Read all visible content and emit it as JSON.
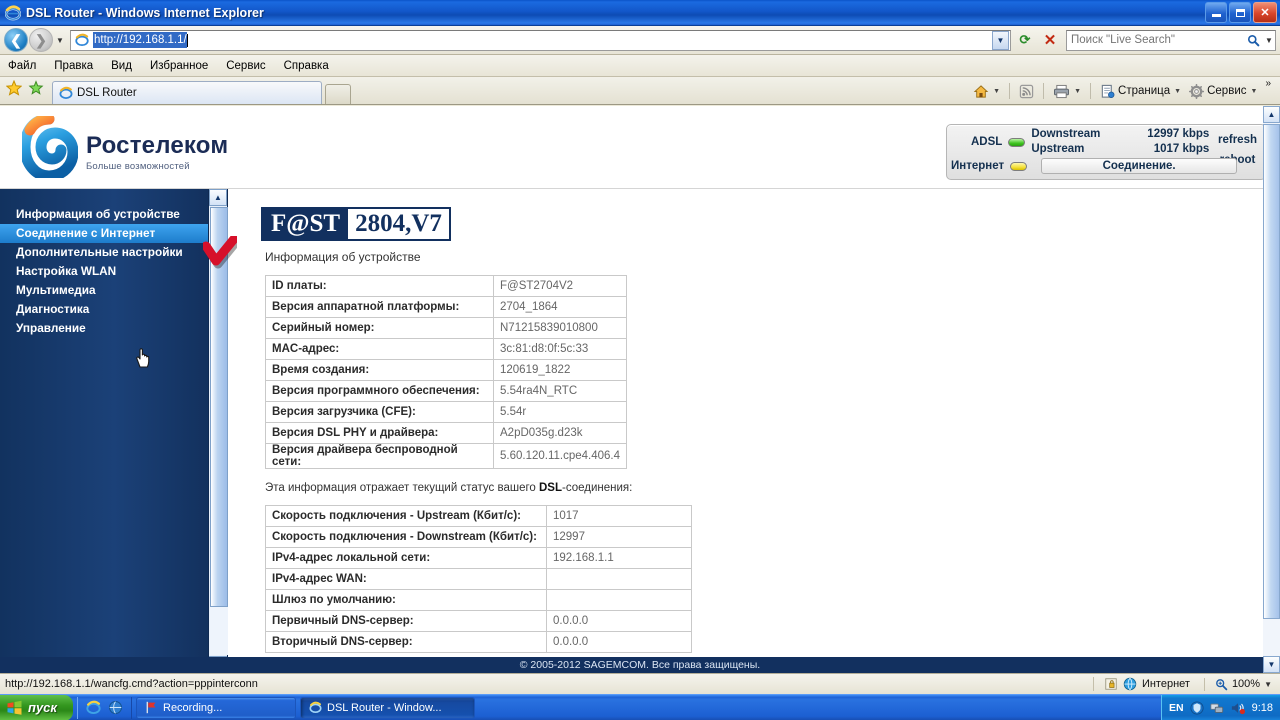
{
  "window": {
    "title": "DSL Router - Windows Internet Explorer",
    "minimize_label": "Свернуть",
    "maximize_label": "Развернуть",
    "close_label": "Закрыть"
  },
  "address_bar": {
    "back_label": "Назад",
    "forward_label": "Вперёд",
    "history_label": "Последние страницы",
    "url": "http://192.168.1.1/",
    "refresh_label": "Обновить",
    "stop_label": "Остановить",
    "search_placeholder": "Поиск \"Live Search\""
  },
  "menu": {
    "items": [
      "Файл",
      "Правка",
      "Вид",
      "Избранное",
      "Сервис",
      "Справка"
    ]
  },
  "tabs": {
    "favorites_label": "Избранное",
    "add_favorite_label": "Добавить в избранное",
    "items": [
      {
        "label": "DSL Router"
      }
    ],
    "new_tab_label": ""
  },
  "command_bar": {
    "home": "",
    "feeds": "",
    "print": "",
    "page": "Страница",
    "tools": "Сервис",
    "overflow": "»"
  },
  "brand": {
    "name": "Ростелеком",
    "slogan": "Больше возможностей"
  },
  "status_panel": {
    "adsl_label": "ADSL",
    "adsl_led": "#3fc420",
    "downstream_label": "Downstream",
    "downstream_value": "12997 kbps",
    "upstream_label": "Upstream",
    "upstream_value": "1017 kbps",
    "refresh": "refresh",
    "reboot": "reboot",
    "internet_label": "Интернет",
    "internet_led": "#f4e03a",
    "connection_status": "Соединение."
  },
  "sidebar": {
    "items": [
      {
        "label": "Информация об устройстве",
        "active": false
      },
      {
        "label": "Соединение с Интернет",
        "active": true
      },
      {
        "label": "Дополнительные настройки",
        "active": false
      },
      {
        "label": "Настройка WLAN",
        "active": false
      },
      {
        "label": "Мультимедиа",
        "active": false
      },
      {
        "label": "Диагностика",
        "active": false
      },
      {
        "label": "Управление",
        "active": false
      }
    ]
  },
  "content": {
    "logo_prefix": "F@ST",
    "logo_model": "2804,V7",
    "section_title": "Информация об устройстве",
    "device_table": [
      {
        "key": "ID платы:",
        "value": "F@ST2704V2"
      },
      {
        "key": "Версия аппаратной платформы:",
        "value": "2704_1864"
      },
      {
        "key": "Серийный номер:",
        "value": "N71215839010800"
      },
      {
        "key": "MAC-адрес:",
        "value": "3c:81:d8:0f:5c:33"
      },
      {
        "key": "Время создания:",
        "value": "120619_1822"
      },
      {
        "key": "Версия программного обеспечения:",
        "value": "5.54ra4N_RTC"
      },
      {
        "key": "Версия загрузчика (CFE):",
        "value": "5.54r"
      },
      {
        "key": "Версия DSL PHY и драйвера:",
        "value": "A2pD035g.d23k"
      },
      {
        "key": "Версия драйвера беспроводной сети:",
        "value": "5.60.120.11.cpe4.406.4"
      }
    ],
    "dsl_note_prefix": "Эта информация отражает текущий статус вашего ",
    "dsl_note_bold": "DSL",
    "dsl_note_suffix": "-соединения:",
    "dsl_table": [
      {
        "key": "Скорость подключения - Upstream (Кбит/с):",
        "value": "1017"
      },
      {
        "key": "Скорость подключения - Downstream (Кбит/с):",
        "value": "12997"
      },
      {
        "key": "IPv4-адрес локальной сети:",
        "value": "192.168.1.1"
      },
      {
        "key": "IPv4-адрес WAN:",
        "value": ""
      },
      {
        "key": "Шлюз по умолчанию:",
        "value": ""
      },
      {
        "key": "Первичный DNS-сервер:",
        "value": "0.0.0.0"
      },
      {
        "key": "Вторичный DNS-сервер:",
        "value": "0.0.0.0"
      }
    ],
    "footer": "© 2005-2012 SAGEMCOM. Все права защищены."
  },
  "ie_status_bar": {
    "link_url": "http://192.168.1.1/wancfg.cmd?action=pppinterconn",
    "zone": "Интернет",
    "zoom": "100%"
  },
  "taskbar": {
    "start_label": "пуск",
    "tasks": [
      {
        "label": "Recording...",
        "active": false
      },
      {
        "label": "DSL Router - Window...",
        "active": true
      }
    ],
    "language": "EN",
    "clock": "9:18"
  }
}
